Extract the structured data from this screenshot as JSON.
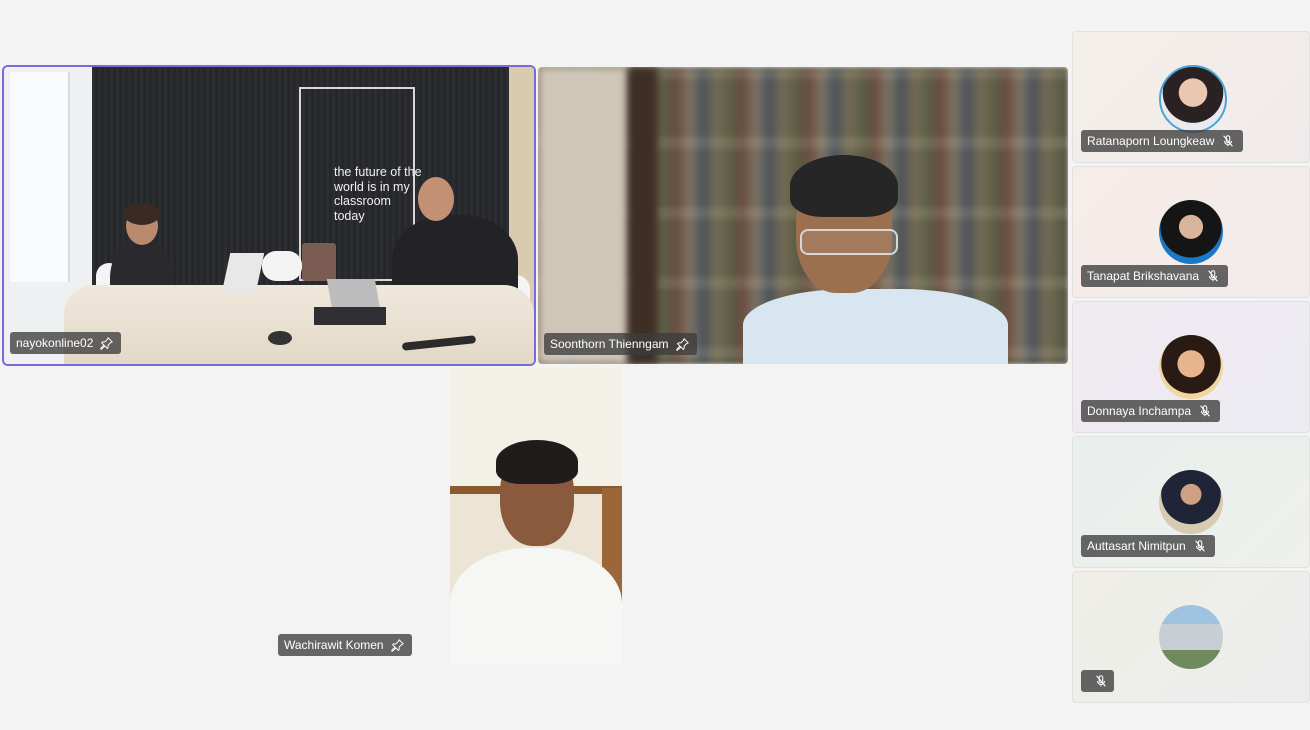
{
  "participants": {
    "main": [
      {
        "name": "nayokonline02",
        "pinned": true,
        "active_speaker": true
      },
      {
        "name": "Soonthorn Thienngam",
        "pinned": true,
        "active_speaker": false
      },
      {
        "name": "Wachirawit Komen",
        "pinned": true,
        "active_speaker": false
      }
    ],
    "sidebar": [
      {
        "name": "Ratanaporn Loungkeaw",
        "muted": true,
        "icon": "mic-off-icon"
      },
      {
        "name": "Tanapat Brikshavana",
        "muted": true,
        "icon": "mic-off-icon"
      },
      {
        "name": "Donnaya Inchampa",
        "muted": true,
        "icon": "mic-off-icon"
      },
      {
        "name": "Auttasart Nimitpun",
        "muted": true,
        "icon": "mic-off-icon"
      },
      {
        "name": "",
        "muted": true,
        "icon": "mic-off-icon"
      }
    ]
  },
  "scene": {
    "poster_text": "the future of the world is in my classroom today"
  },
  "colors": {
    "background": "#f3f3f3",
    "active_outline": "#7b68d9",
    "pill_bg": "rgba(60,60,60,0.78)"
  }
}
